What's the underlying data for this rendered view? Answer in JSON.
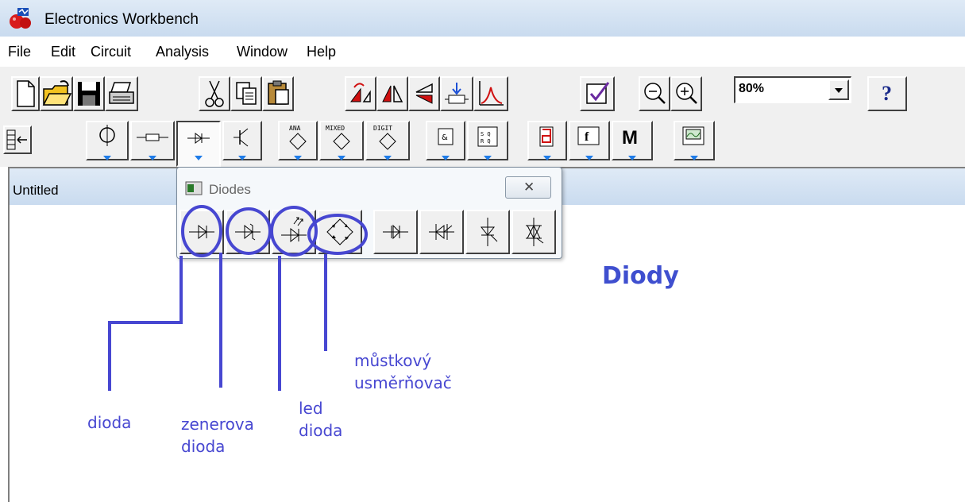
{
  "window": {
    "title": "Electronics Workbench"
  },
  "menu": [
    "File",
    "Edit",
    "Circuit",
    "Analysis",
    "Window",
    "Help"
  ],
  "toolbar": {
    "zoom_value": "80%",
    "help_label": "?",
    "icons": [
      "new-icon",
      "open-icon",
      "save-icon",
      "print-icon",
      "cut-icon",
      "copy-icon",
      "paste-icon",
      "rotate-icon",
      "flip-horizontal-icon",
      "flip-vertical-icon",
      "subcircuit-icon",
      "graph-icon",
      "component-properties-icon",
      "zoom-out-icon",
      "zoom-in-icon",
      "help-icon"
    ]
  },
  "parts_bin": {
    "labels": {
      "ana": "ANA",
      "mixed": "MIXED",
      "digit": "DIGIT",
      "m": "M",
      "f": "f"
    }
  },
  "document": {
    "title": "Untitled"
  },
  "palette": {
    "title": "Diodes",
    "close_label": "✕"
  },
  "annotations": {
    "heading": "Diody",
    "dioda": "dioda",
    "zener_1": "zenerova",
    "zener_2": "dioda",
    "led_1": "led",
    "led_2": "dioda",
    "bridge_1": "můstkový",
    "bridge_2": "usměrňovač"
  },
  "colors": {
    "annotation": "#4747d1",
    "toolbar_bg": "#f0f0f0",
    "title_gradient": "#c9dbef"
  }
}
